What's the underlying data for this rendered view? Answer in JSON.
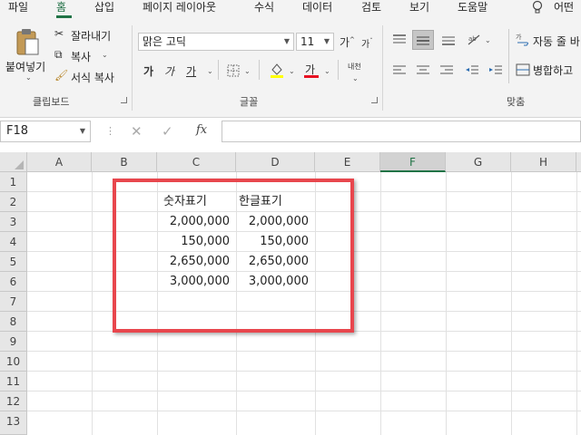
{
  "ribbon": {
    "tabs": [
      "파일",
      "홈",
      "삽입",
      "페이지 레이아웃",
      "수식",
      "데이터",
      "검토",
      "보기",
      "도움말"
    ],
    "active_tab": "홈",
    "tellme": "어떤",
    "clipboard": {
      "paste": "붙여넣기",
      "cut": "잘라내기",
      "copy": "복사",
      "format_painter": "서식 복사",
      "group_label": "클립보드"
    },
    "font": {
      "name": "맑은 고딕",
      "size": "11",
      "bold_glyph": "가",
      "italic_glyph": "가",
      "underline_glyph": "가",
      "grow_glyph": "가",
      "shrink_glyph": "가",
      "font_color_glyph": "가",
      "phonetic_glyph": "내천",
      "group_label": "글꼴"
    },
    "alignment": {
      "wrap_text": "자동 줄 바",
      "merge_center": "병합하고",
      "group_label": "맞춤"
    }
  },
  "formula_bar": {
    "name_box": "F18",
    "fx": "fx",
    "formula": ""
  },
  "sheet": {
    "columns": [
      "A",
      "B",
      "C",
      "D",
      "E",
      "F",
      "G",
      "H"
    ],
    "selected_column": "F",
    "rows": [
      "1",
      "2",
      "3",
      "4",
      "5",
      "6",
      "7",
      "8",
      "9",
      "10",
      "11",
      "12",
      "13"
    ],
    "headers": {
      "c": "숫자표기",
      "d": "한글표기"
    },
    "data": [
      {
        "c": "2,000,000",
        "d": "2,000,000"
      },
      {
        "c": "150,000",
        "d": "150,000"
      },
      {
        "c": "2,650,000",
        "d": "2,650,000"
      },
      {
        "c": "3,000,000",
        "d": "3,000,000"
      }
    ]
  },
  "colors": {
    "accent": "#217346",
    "highlight_box": "#e8464d",
    "font_color_bar": "#e81123",
    "fill_color_bar": "#ffff00"
  }
}
